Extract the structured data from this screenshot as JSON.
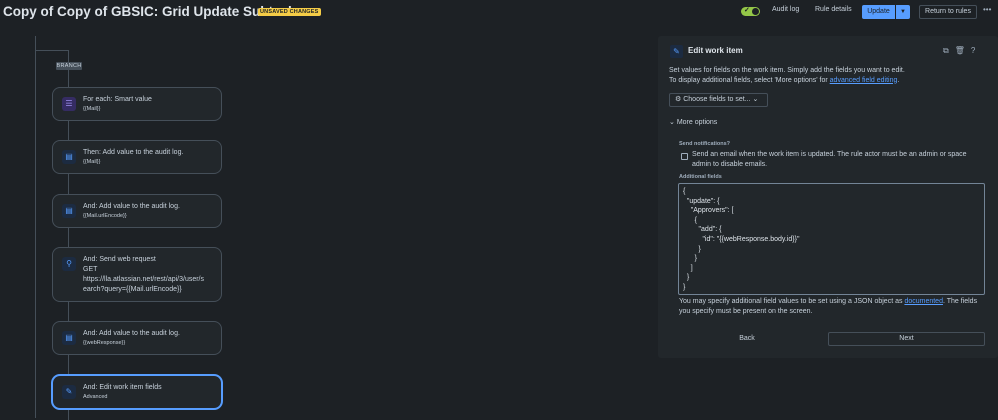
{
  "header": {
    "title": "Copy of Copy of GBSIC: Grid Update Subtasks",
    "unsaved_badge": "UNSAVED CHANGES",
    "audit_log": "Audit log",
    "rule_details": "Rule details",
    "update": "Update",
    "return_to_rules": "Return to rules",
    "toggle_on": true
  },
  "canvas": {
    "branch_label": "BRANCH",
    "cards": [
      {
        "icon": "list-icon",
        "title": "For each: Smart value",
        "sub": "{{Mail}}"
      },
      {
        "icon": "audit-log-icon",
        "title": "Then: Add value to the audit log.",
        "sub": "{{Mail}}"
      },
      {
        "icon": "audit-log-icon",
        "title": "And: Add value to the audit log.",
        "sub": "{{Mail.urlEncode}}"
      },
      {
        "icon": "web-request-icon",
        "title": "And: Send web request",
        "line2": "GET",
        "line3": "https://lla.atlassian.net/rest/api/3/user/s",
        "line4": "earch?query={{Mail.urlEncode}}"
      },
      {
        "icon": "audit-log-icon",
        "title": "And: Add value to the audit log.",
        "sub": "{{webResponse}}"
      },
      {
        "icon": "edit-icon",
        "title": "And: Edit work item fields",
        "sub": "Advanced"
      }
    ]
  },
  "panel": {
    "title": "Edit work item",
    "desc_1": "Set values for fields on the work item. Simply add the fields you want to edit.",
    "desc_2": "To display additional fields, select 'More options' for ",
    "desc_link": "advanced field editing",
    "desc_end": ".",
    "choose_fields": "Choose fields to set...",
    "more_options": "More options",
    "send_notifications_label": "Send notifications?",
    "send_email_text": "Send an email when the work item is updated. The rule actor must be an admin or space admin to disable emails.",
    "additional_fields_label": "Additional fields",
    "additional_fields_value": "{\n  \"update\": {\n    \"Approvers\": [\n      {\n        \"add\": {\n          \"id\": \"{{webResponse.body.id}}\"\n        }\n      }\n    ]\n  }\n}",
    "footer_1": "You may specify additional field values to be set using a JSON object as ",
    "footer_link": "documented",
    "footer_2": ". The fields you specify must be present on the screen.",
    "back": "Back",
    "next": "Next"
  }
}
